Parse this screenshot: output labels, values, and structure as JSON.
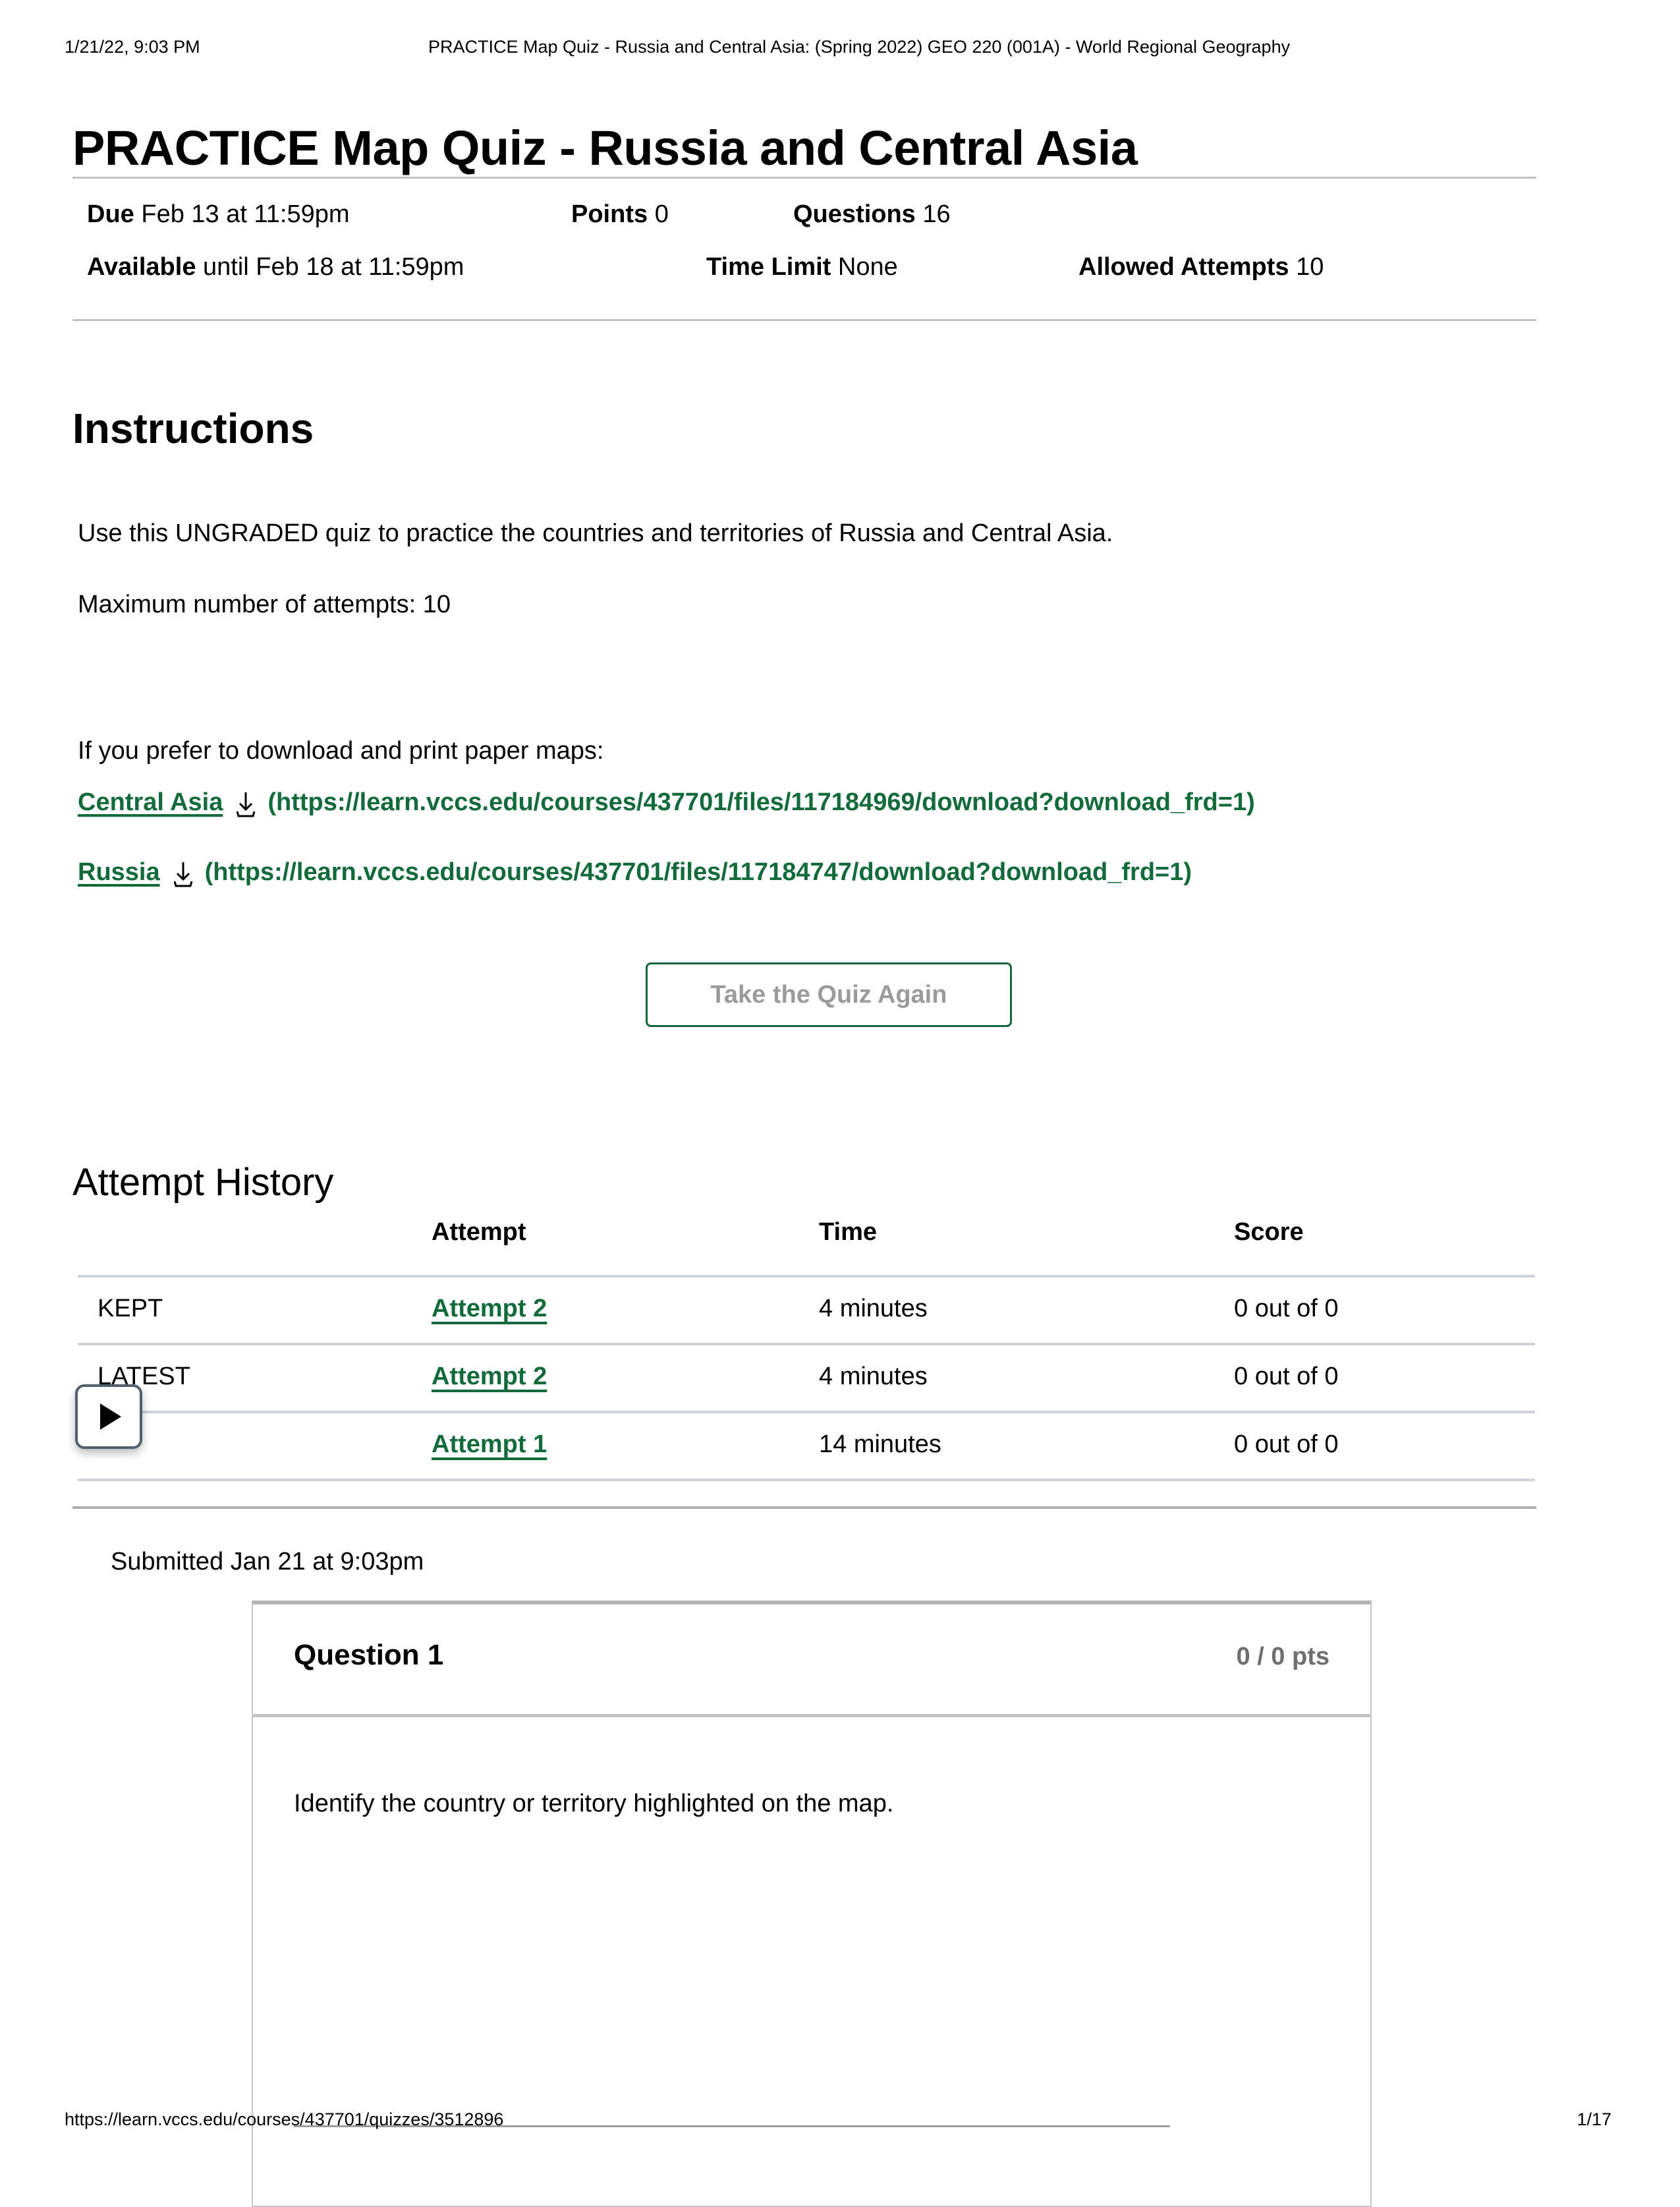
{
  "print_header": {
    "date": "1/21/22, 9:03 PM",
    "title": "PRACTICE Map Quiz - Russia and Central Asia: (Spring 2022) GEO 220 (001A) - World Regional Geography"
  },
  "quiz": {
    "title": "PRACTICE Map Quiz - Russia and Central Asia"
  },
  "meta": {
    "due_label": "Due",
    "due_value": "Feb 13 at 11:59pm",
    "points_label": "Points",
    "points_value": "0",
    "questions_label": "Questions",
    "questions_value": "16",
    "available_label": "Available",
    "available_value": "until Feb 18 at 11:59pm",
    "time_limit_label": "Time Limit",
    "time_limit_value": "None",
    "allowed_attempts_label": "Allowed Attempts",
    "allowed_attempts_value": "10"
  },
  "instructions": {
    "heading": "Instructions",
    "paragraph_1": "Use this UNGRADED quiz to practice the countries and territories of Russia and Central Asia.",
    "paragraph_2": "Maximum number of attempts: 10",
    "paragraph_3": "If you prefer to download and print paper maps:"
  },
  "downloads": [
    {
      "name": "Central Asia",
      "icon": "download-icon",
      "url": "(https://learn.vccs.edu/courses/437701/files/117184969/download?download_frd=1)"
    },
    {
      "name": "Russia",
      "icon": "download-icon",
      "url": "(https://learn.vccs.edu/courses/437701/files/117184747/download?download_frd=1)"
    }
  ],
  "actions": {
    "take_quiz_again": "Take the Quiz Again"
  },
  "attempt_history": {
    "heading": "Attempt History",
    "columns": [
      "",
      "Attempt",
      "Time",
      "Score"
    ],
    "rows": [
      {
        "badge": "KEPT",
        "attempt": "Attempt 2 ",
        "time": "4 minutes",
        "score": "0 out of 0"
      },
      {
        "badge": "LATEST",
        "attempt": "Attempt 2 ",
        "time": "4 minutes",
        "score": "0 out of 0"
      },
      {
        "badge": "",
        "attempt": "Attempt 1 ",
        "time": "14 minutes",
        "score": "0 out of 0"
      }
    ]
  },
  "overlay": {
    "play_icon": "play-icon"
  },
  "submission": {
    "submitted_text": "Submitted Jan 21 at 9:03pm"
  },
  "question": {
    "title": "Question 1",
    "points": "0 / 0 pts",
    "text": "Identify the country or territory highlighted on the map."
  },
  "footer": {
    "url": "https://learn.vccs.edu/courses/437701/quizzes/3512896",
    "page": "1/17"
  },
  "colors": {
    "link_green": "#136a3a",
    "button_border_green": "#14663c",
    "button_text_gray": "#9b9b9b",
    "rule_gray": "#c2c2c2",
    "table_border": "#ced4da",
    "points_gray": "#6f6f6f"
  }
}
